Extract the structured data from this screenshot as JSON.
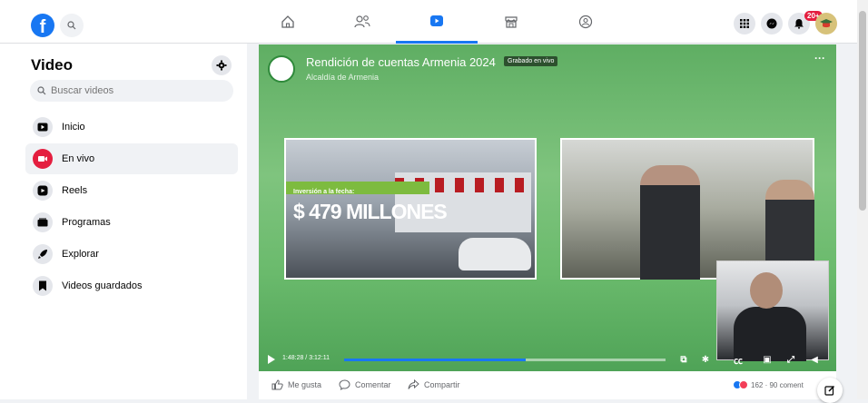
{
  "header": {
    "logo_letter": "f",
    "notification_badge": "20+",
    "nav_tabs": [
      "home-icon",
      "friends-icon",
      "video-icon",
      "marketplace-icon",
      "groups-icon"
    ],
    "active_tab": "video-icon"
  },
  "sidebar": {
    "title": "Video",
    "search_placeholder": "Buscar videos",
    "items": [
      {
        "label": "Inicio",
        "icon": "play-icon"
      },
      {
        "label": "En vivo",
        "icon": "live-icon"
      },
      {
        "label": "Reels",
        "icon": "reels-icon"
      },
      {
        "label": "Programas",
        "icon": "shows-icon"
      },
      {
        "label": "Explorar",
        "icon": "rocket-icon"
      },
      {
        "label": "Videos guardados",
        "icon": "bookmark-icon"
      }
    ],
    "active_item": "En vivo"
  },
  "video": {
    "title": "Rendición de cuentas Armenia 2024",
    "live_badge": "Grabado en vivo",
    "channel": "Alcaldía de Armenia",
    "overlay_strip": "Inversión a la fecha:",
    "overlay_amount": "$ 479 MILLONES",
    "current_time": "1:48:28",
    "duration": "3:12:11",
    "time_display": "1:48:28 / 3:12:11",
    "progress": 0.565
  },
  "actions": {
    "like": "Me gusta",
    "comment": "Comentar",
    "share": "Compartir",
    "reactions_text": "162 · 90 coment"
  },
  "colors": {
    "accent": "#1877f2",
    "live": "#e41e3f",
    "video_green": "#6aba6c"
  }
}
